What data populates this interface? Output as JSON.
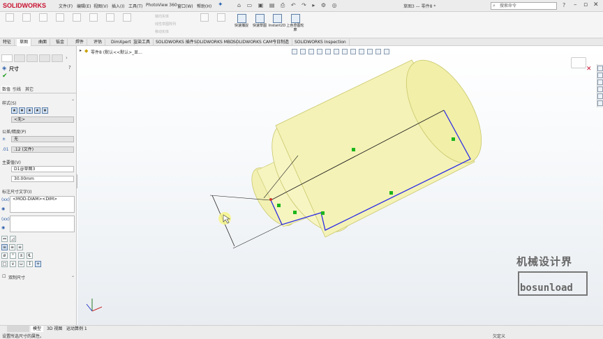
{
  "app": {
    "logo": "SOLIDWORKS",
    "doc_title": "草图3 — 零件8 *"
  },
  "menu": [
    "文件(F)",
    "编辑(E)",
    "视图(V)",
    "插入(I)",
    "工具(T)",
    "PhotoView 360",
    "窗口(W)",
    "帮助(H)"
  ],
  "search": {
    "placeholder": "搜索命令"
  },
  "ribbon": {
    "small_items": [
      "镜向实体",
      "线性草图阵列",
      "移动实体"
    ],
    "big_buttons": [
      "快速捕捉",
      "快速草图",
      "Instant2D",
      "上色草图轮廓"
    ]
  },
  "command_tabs": [
    "特征",
    "草图",
    "曲面",
    "钣金",
    "焊件",
    "评估",
    "DimXpert",
    "渲染工具",
    "SOLIDWORKS 插件",
    "SOLIDWORKS MBD",
    "SOLIDWORKS CAM",
    "今日制造",
    "SOLIDWORKS Inspection"
  ],
  "active_command_tab": "草图",
  "tree": {
    "path": "零件8 (默认<<默认>_显..."
  },
  "property": {
    "title": "尺寸",
    "subtabs": [
      "数值",
      "引线",
      "其它"
    ],
    "style": {
      "header": "样式(S)",
      "value": "<无>"
    },
    "tolerance": {
      "header": "公差/精度(P)",
      "tol_type": "无",
      "precision": ".12 (文件)"
    },
    "primary": {
      "header": "主要值(V)",
      "name": "D1@草图3",
      "value": "30.00mm"
    },
    "dimtext": {
      "header": "标注尺寸文字(I)",
      "text": "<MOD-DIAM><DIM>"
    },
    "dual": {
      "header": "双制尺寸"
    }
  },
  "bottom_tabs": [
    "模型",
    "3D 视图",
    "运动算例 1"
  ],
  "status": {
    "message": "设置所选尺寸的属性。",
    "right": "欠定义"
  },
  "watermark": {
    "cn": "机械设计界",
    "en": "bosunload"
  },
  "colors": {
    "model_fill": "#f5f3b8",
    "sketch_line": "#2d2de6",
    "relation_marker": "#1bb51b",
    "accent": "#c8102e"
  }
}
